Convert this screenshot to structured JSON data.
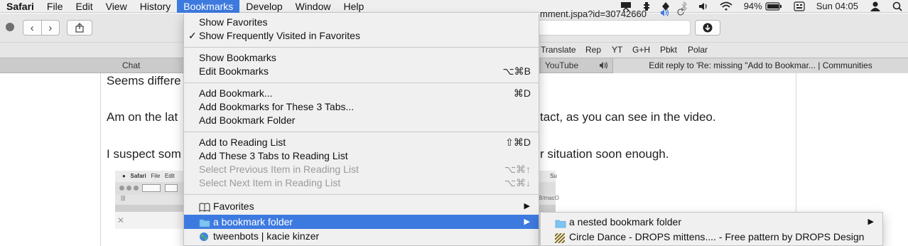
{
  "menubar": {
    "app": "Safari",
    "items": [
      "File",
      "Edit",
      "View",
      "History",
      "Bookmarks",
      "Develop",
      "Window",
      "Help"
    ],
    "active": "Bookmarks",
    "status": {
      "battery": "94%",
      "clock": "Sun 04:05",
      "icons": [
        "presentation-icon",
        "bell-icon",
        "app-icon",
        "bluetooth-icon",
        "volume-icon",
        "wifi-icon",
        "battery-icon",
        "input-menu-icon",
        "user-icon",
        "spotlight-icon"
      ]
    }
  },
  "toolbar": {
    "back": "‹",
    "forward": "›",
    "url_text": "mment.jspa?id=30742660"
  },
  "bookmarks_bar": {
    "items": [
      "Translate",
      "Rep",
      "YT",
      "G+H",
      "Pbkt",
      "Polar"
    ]
  },
  "tabs": {
    "items": [
      "Chat",
      "YouTube",
      "Edit reply to 'Re: missing \"Add to Bookmar... | Communities"
    ]
  },
  "content": {
    "lines": [
      "Seems differe",
      "Am on the lat",
      "tact, as you can see in the video.",
      "I suspect som",
      "r situation soon enough."
    ],
    "thumb": {
      "menu_items": [
        "Safari",
        "File",
        "Edit"
      ],
      "partial": "Su",
      "tabs_text": "|||",
      "right_text": "B/macO"
    }
  },
  "bookmarks_menu": {
    "items": [
      {
        "label": "Show Favorites",
        "shortcut": "",
        "checked": false,
        "disabled": false
      },
      {
        "label": "Show Frequently Visited in Favorites",
        "shortcut": "",
        "checked": true,
        "disabled": false
      },
      {
        "label": "Show Bookmarks",
        "shortcut": "",
        "checked": false,
        "disabled": false
      },
      {
        "label": "Edit Bookmarks",
        "shortcut": "⌥⌘B",
        "checked": false,
        "disabled": false
      },
      {
        "label": "Add Bookmark...",
        "shortcut": "⌘D",
        "checked": false,
        "disabled": false
      },
      {
        "label": "Add Bookmarks for These 3 Tabs...",
        "shortcut": "",
        "checked": false,
        "disabled": false
      },
      {
        "label": "Add Bookmark Folder",
        "shortcut": "",
        "checked": false,
        "disabled": false
      },
      {
        "label": "Add to Reading List",
        "shortcut": "⇧⌘D",
        "checked": false,
        "disabled": false
      },
      {
        "label": "Add These 3 Tabs to Reading List",
        "shortcut": "",
        "checked": false,
        "disabled": false
      },
      {
        "label": "Select Previous Item in Reading List",
        "shortcut": "⌥⌘↑",
        "checked": false,
        "disabled": true
      },
      {
        "label": "Select Next Item in Reading List",
        "shortcut": "⌥⌘↓",
        "checked": false,
        "disabled": true
      },
      {
        "label": "Favorites",
        "shortcut": "",
        "icon": "book-icon",
        "submenu": true
      },
      {
        "label": "a bookmark folder",
        "shortcut": "",
        "icon": "folder-icon",
        "submenu": true,
        "highlighted": true
      },
      {
        "label": "tweenbots | kacie kinzer",
        "shortcut": "",
        "icon": "globe-icon"
      }
    ],
    "checkmark": "✓"
  },
  "submenu": {
    "items": [
      {
        "label": "a nested bookmark folder",
        "icon": "folder-icon",
        "submenu": true
      },
      {
        "label": "Circle Dance - DROPS mittens.... - Free pattern by DROPS Design",
        "icon": "drops-favicon"
      }
    ],
    "arrow": "▶"
  },
  "colors": {
    "accent": "#3d7ae0",
    "menu_bg": "#f0f0f0",
    "disabled_text": "#9a9a9a"
  }
}
